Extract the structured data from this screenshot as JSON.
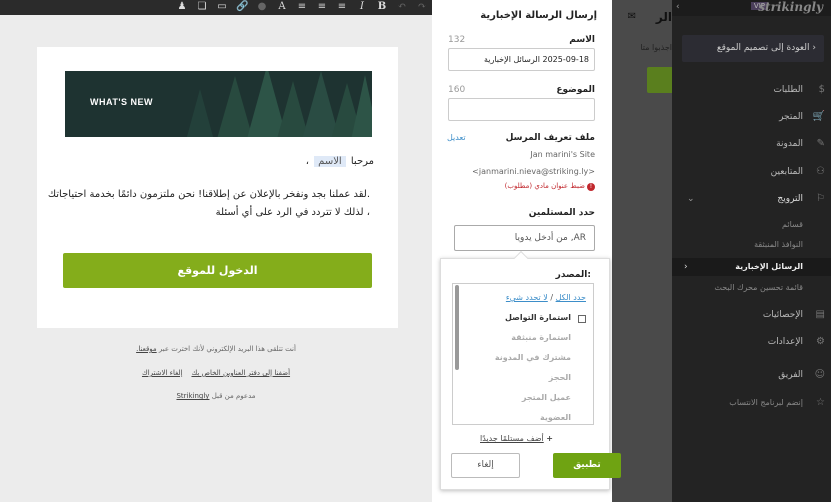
{
  "sidebar": {
    "logo": "strikingly",
    "vip": "VIP",
    "back": "العودة إلى تصميم الموقع",
    "items": [
      {
        "label": "الطلبات",
        "icon": "dollar-icon"
      },
      {
        "label": "المتجر",
        "icon": "cart-icon"
      },
      {
        "label": "المدونة",
        "icon": "pencil-icon"
      },
      {
        "label": "المتابعين",
        "icon": "contacts-icon"
      },
      {
        "label": "الترويج",
        "icon": "megaphone-icon"
      },
      {
        "label": "الإحصائيات",
        "icon": "chart-icon"
      },
      {
        "label": "الإعدادات",
        "icon": "gear-icon"
      },
      {
        "label": "الفريق",
        "icon": "team-icon"
      },
      {
        "label": "إنضم لبرنامج الانتساب",
        "icon": "star-icon"
      }
    ],
    "subitems": [
      "قسائم",
      "النوافذ المنبثقة",
      "الرسائل الإخبارية",
      "قائمة تحسين محرك البحث"
    ]
  },
  "dash": {
    "title": "الر",
    "sub": "اجذبوا متا",
    "btn": "+ إنشا"
  },
  "email": {
    "hero": "WHAT'S NEW",
    "greeting": "مرحبا",
    "name_chip": "الاسم",
    "comma": "،",
    "body1": ".لقد عملنا بجد ونفخر بالإعلان عن إطلاقنا! نحن ملتزمون دائمًا بخدمة احتياجاتك",
    "body2": "، لذلك لا تتردد في الرد على أي أسئلة",
    "cta": "الدخول للموقع",
    "foot1": "أنت تتلقى هذا البريد الإلكتروني لأنك اخترت عبر",
    "foot1_link": "موقعنا.",
    "foot2a": "أضفنا إلى دفتر العناوين الخاص بك",
    "foot2b": "إلغاء الاشتراك",
    "foot3": "مدعوم من قبل",
    "foot3_link": "Strikingly"
  },
  "panel": {
    "title": "إرسال الرسالة الإخبارية",
    "name_label": "الاسم",
    "name_count": "132",
    "name_value": "2025-09-18 الرسائل الإخبارية",
    "subject_label": "الموضوع",
    "subject_count": "160",
    "subject_value": "",
    "sender_label": "ملف تعريف المرسل",
    "edit": "تعديل",
    "site": "Jan marini's Site",
    "email": "<janmarini.nieva@striking.ly>",
    "warn": "ضبط عنوان مادي (مطلوب)",
    "recipients_label": "حدد المستلمين",
    "recipients_placeholder": "AR, من أدخل يدويا"
  },
  "popup": {
    "source_label": ":المصدر",
    "select_all": "حدد الكل",
    "separator": "/",
    "select_none": "لا تحدد شيء",
    "options": [
      "استمارة التواصل",
      "استمارة منبثقة",
      "مشترك في المدونة",
      "الحجز",
      "عميل المتجر",
      "العضوية"
    ],
    "add_new": "أضف مستلمًا جديدًا",
    "plus": "+",
    "apply": "تطبيق",
    "cancel": "إلغاء"
  }
}
